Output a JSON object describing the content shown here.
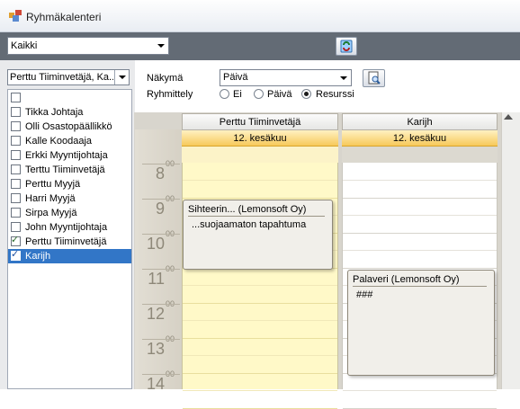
{
  "window": {
    "title": "Ryhmäkalenteri"
  },
  "toolbar": {
    "group_select_value": "Kaikki"
  },
  "left_panel": {
    "user_select_value": "Perttu Tiiminvetäjä, Ka...",
    "users": [
      {
        "label": "",
        "checked": false,
        "selected": false
      },
      {
        "label": "Tikka Johtaja",
        "checked": false,
        "selected": false
      },
      {
        "label": "Olli Osastopäällikkö",
        "checked": false,
        "selected": false
      },
      {
        "label": "Kalle Koodaaja",
        "checked": false,
        "selected": false
      },
      {
        "label": "Erkki Myyntijohtaja",
        "checked": false,
        "selected": false
      },
      {
        "label": "Terttu Tiiminvetäjä",
        "checked": false,
        "selected": false
      },
      {
        "label": "Perttu Myyjä",
        "checked": false,
        "selected": false
      },
      {
        "label": "Harri Myyjä",
        "checked": false,
        "selected": false
      },
      {
        "label": "Sirpa Myyjä",
        "checked": false,
        "selected": false
      },
      {
        "label": "John Myyntijohtaja",
        "checked": false,
        "selected": false
      },
      {
        "label": "Perttu Tiiminvetäjä",
        "checked": true,
        "selected": false
      },
      {
        "label": "Karijh",
        "checked": true,
        "selected": true
      }
    ]
  },
  "options": {
    "view_label": "Näkymä",
    "view_value": "Päivä",
    "grouping_label": "Ryhmittely",
    "grouping_options": [
      "Ei",
      "Päivä",
      "Resurssi"
    ],
    "grouping_selected": "Resurssi"
  },
  "calendar": {
    "hours": [
      "8",
      "9",
      "10",
      "11",
      "12",
      "13",
      "14"
    ],
    "hour_suffix": "00",
    "columns": [
      {
        "resource": "Perttu Tiiminvetäjä",
        "date": "12. kesäkuu",
        "events": [
          {
            "title": "Sihteerin... (Lemonsoft Oy)",
            "body": "...suojaamaton tapahtuma"
          }
        ]
      },
      {
        "resource": "Karijh",
        "date": "12. kesäkuu",
        "events": [
          {
            "title": "Palaveri (Lemonsoft Oy)",
            "body": "###"
          }
        ]
      }
    ]
  },
  "colors": {
    "toolbar_bg": "#636b75",
    "selection": "#3276c7",
    "working_hours": "#fff9c8",
    "date_header": "#f7c95a"
  }
}
